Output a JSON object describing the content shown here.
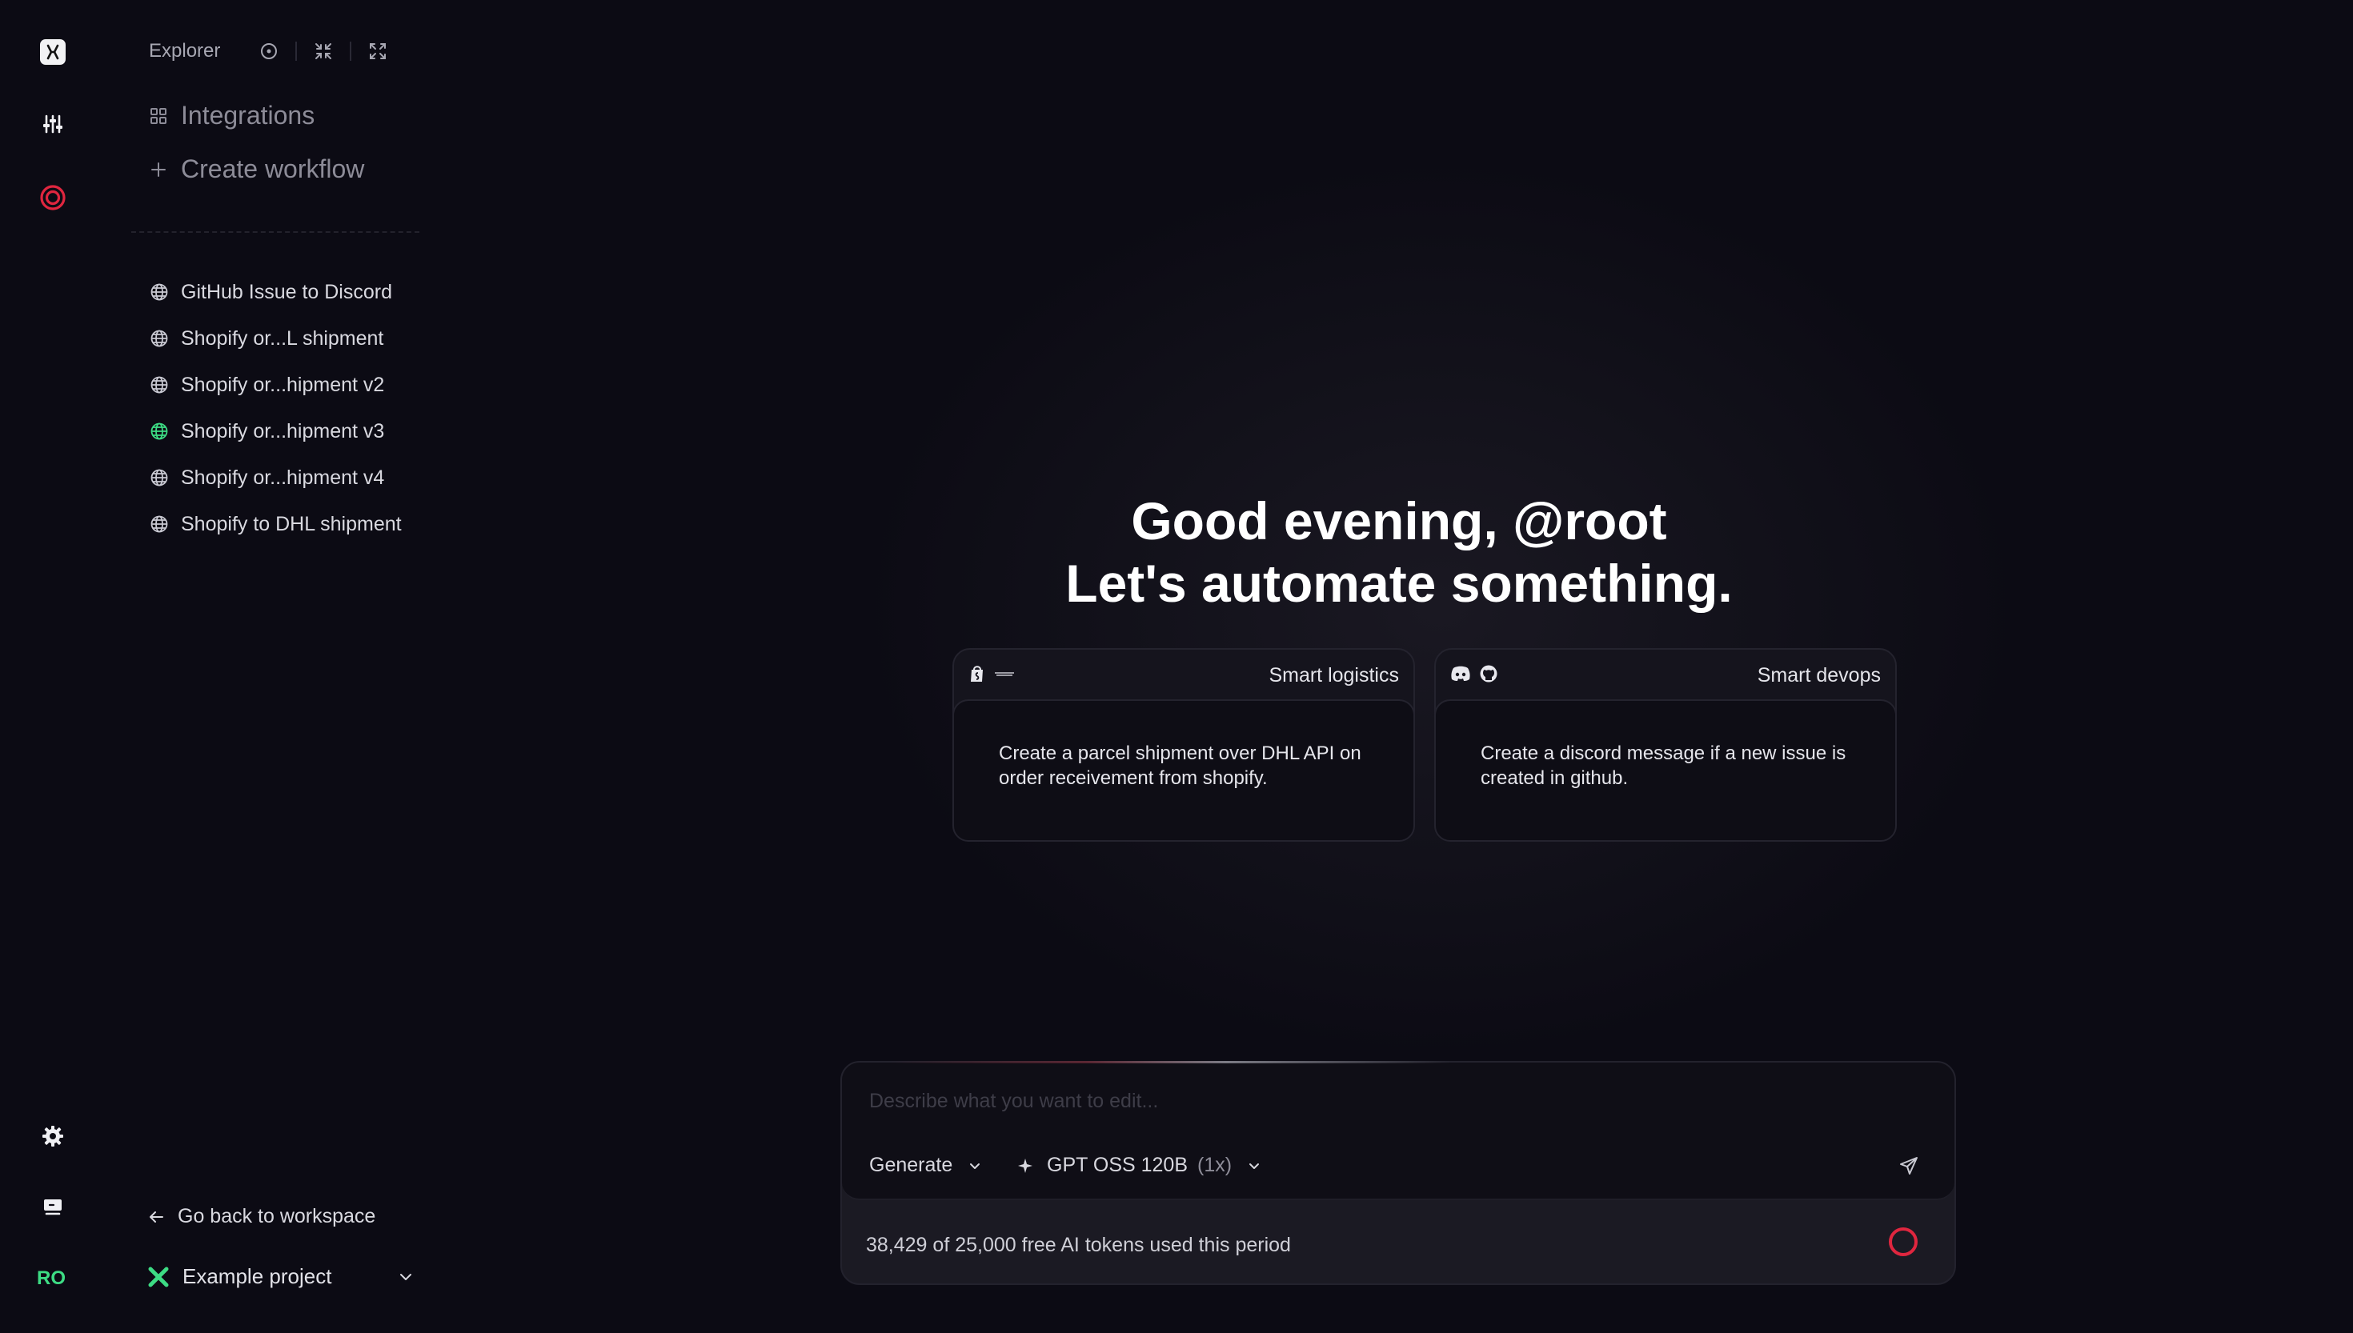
{
  "rail": {
    "initials": "RO",
    "colors": {
      "accent_red": "#e0263f",
      "accent_green": "#3ddc84"
    }
  },
  "sidebar": {
    "explorer_label": "Explorer",
    "nav": [
      {
        "label": "Integrations",
        "icon": "grid-icon"
      },
      {
        "label": "Create workflow",
        "icon": "plus-icon"
      }
    ],
    "workflows": [
      {
        "label": "GitHub Issue to Discord",
        "icon": "globe-icon"
      },
      {
        "label": "Shopify or...L shipment",
        "icon": "globe-icon"
      },
      {
        "label": "Shopify or...hipment v2",
        "icon": "globe-icon"
      },
      {
        "label": "Shopify or...hipment v3",
        "icon": "globe-icon",
        "active": true
      },
      {
        "label": "Shopify or...hipment v4",
        "icon": "globe-icon"
      },
      {
        "label": "Shopify to DHL shipment",
        "icon": "globe-icon"
      }
    ],
    "back_label": "Go back to workspace",
    "project_name": "Example project"
  },
  "main": {
    "greeting_line1": "Good evening, @root",
    "greeting_line2": "Let's automate something.",
    "cards": [
      {
        "title": "Smart logistics",
        "icons": [
          "shopify-icon",
          "dhl-icon"
        ],
        "text": "Create a parcel shipment over DHL API on order receivement from shopify."
      },
      {
        "title": "Smart devops",
        "icons": [
          "discord-icon",
          "github-icon"
        ],
        "text": "Create a discord message if a new issue is created in github."
      }
    ],
    "composer": {
      "placeholder": "Describe what you want to edit...",
      "mode_label": "Generate",
      "model_label": "GPT OSS 120B",
      "model_multiplier": "(1x)",
      "usage_text": "38,429 of 25,000 free AI tokens used this period"
    }
  }
}
